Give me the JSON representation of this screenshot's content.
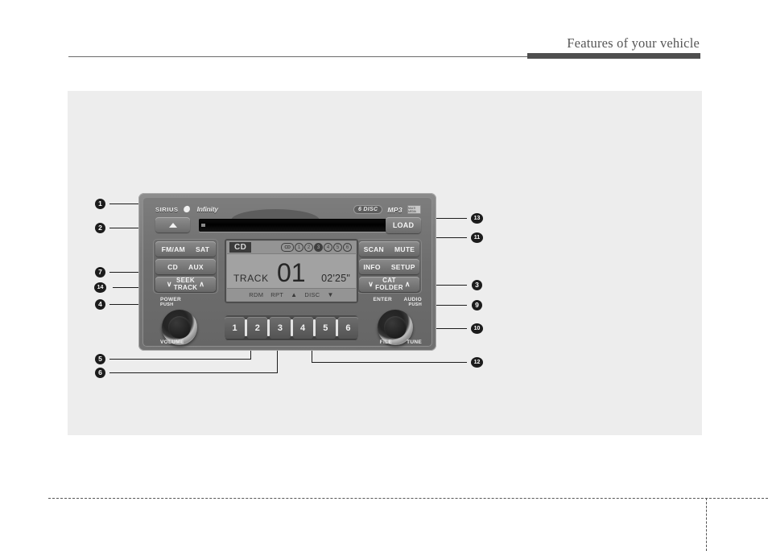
{
  "header": {
    "title": "Features of your vehicle"
  },
  "radio": {
    "brand_sirius": "SIRIUS",
    "brand_infinity": "Infinity",
    "badge_6disc": "6 DISC",
    "badge_mp3": "MP3",
    "badge_logo": "MULTI MEDIA",
    "load_label": "LOAD",
    "eject_icon": "eject-triangle",
    "left_buttons": [
      {
        "left": "FM/AM",
        "right": "SAT"
      },
      {
        "left": "CD",
        "right": "AUX"
      },
      {
        "top": "SEEK",
        "bottom": "TRACK",
        "chev_left": "∨",
        "chev_right": "∧"
      }
    ],
    "right_buttons": [
      {
        "left": "SCAN",
        "right": "MUTE"
      },
      {
        "left": "INFO",
        "right": "SETUP"
      },
      {
        "top": "CAT",
        "bottom": "FOLDER",
        "chev_left": "∨",
        "chev_right": "∧"
      }
    ],
    "knob_left": {
      "top_label": "POWER",
      "top_sub": "PUSH",
      "bottom_label": "VOLUME"
    },
    "knob_right": {
      "top_left_label": "ENTER",
      "top_right_label": "AUDIO",
      "top_right_sub": "PUSH",
      "bottom_left_label": "FILE",
      "bottom_right_label": "TUNE"
    },
    "presets": [
      "1",
      "2",
      "3",
      "4",
      "5",
      "6"
    ]
  },
  "display": {
    "mode": "CD",
    "disc_label": "CD",
    "disc_numbers": [
      "1",
      "2",
      "3",
      "4",
      "5",
      "6"
    ],
    "active_disc": "3",
    "track_label": "TRACK",
    "track_number": "01",
    "time": "02'25\"",
    "status_items": [
      "RDM",
      "RPT",
      "▲",
      "DISC",
      "▼"
    ]
  },
  "callouts": {
    "left": [
      {
        "num": "❶",
        "label": "1"
      },
      {
        "num": "❷",
        "label": "2"
      },
      {
        "num": "❼",
        "label": "7"
      },
      {
        "num": "14",
        "label": "14"
      },
      {
        "num": "❹",
        "label": "4"
      },
      {
        "num": "❺",
        "label": "5"
      },
      {
        "num": "❻",
        "label": "6"
      }
    ],
    "right": [
      {
        "num": "13",
        "label": "13"
      },
      {
        "num": "11",
        "label": "11"
      },
      {
        "num": "❸",
        "label": "3"
      },
      {
        "num": "❾",
        "label": "9"
      },
      {
        "num": "10",
        "label": "10"
      },
      {
        "num": "12",
        "label": "12"
      }
    ]
  },
  "colors": {
    "panel_bg": "#ededed",
    "header_bar": "#4f4f4f",
    "header_text": "#565656",
    "callout": "#1c1c1c"
  }
}
